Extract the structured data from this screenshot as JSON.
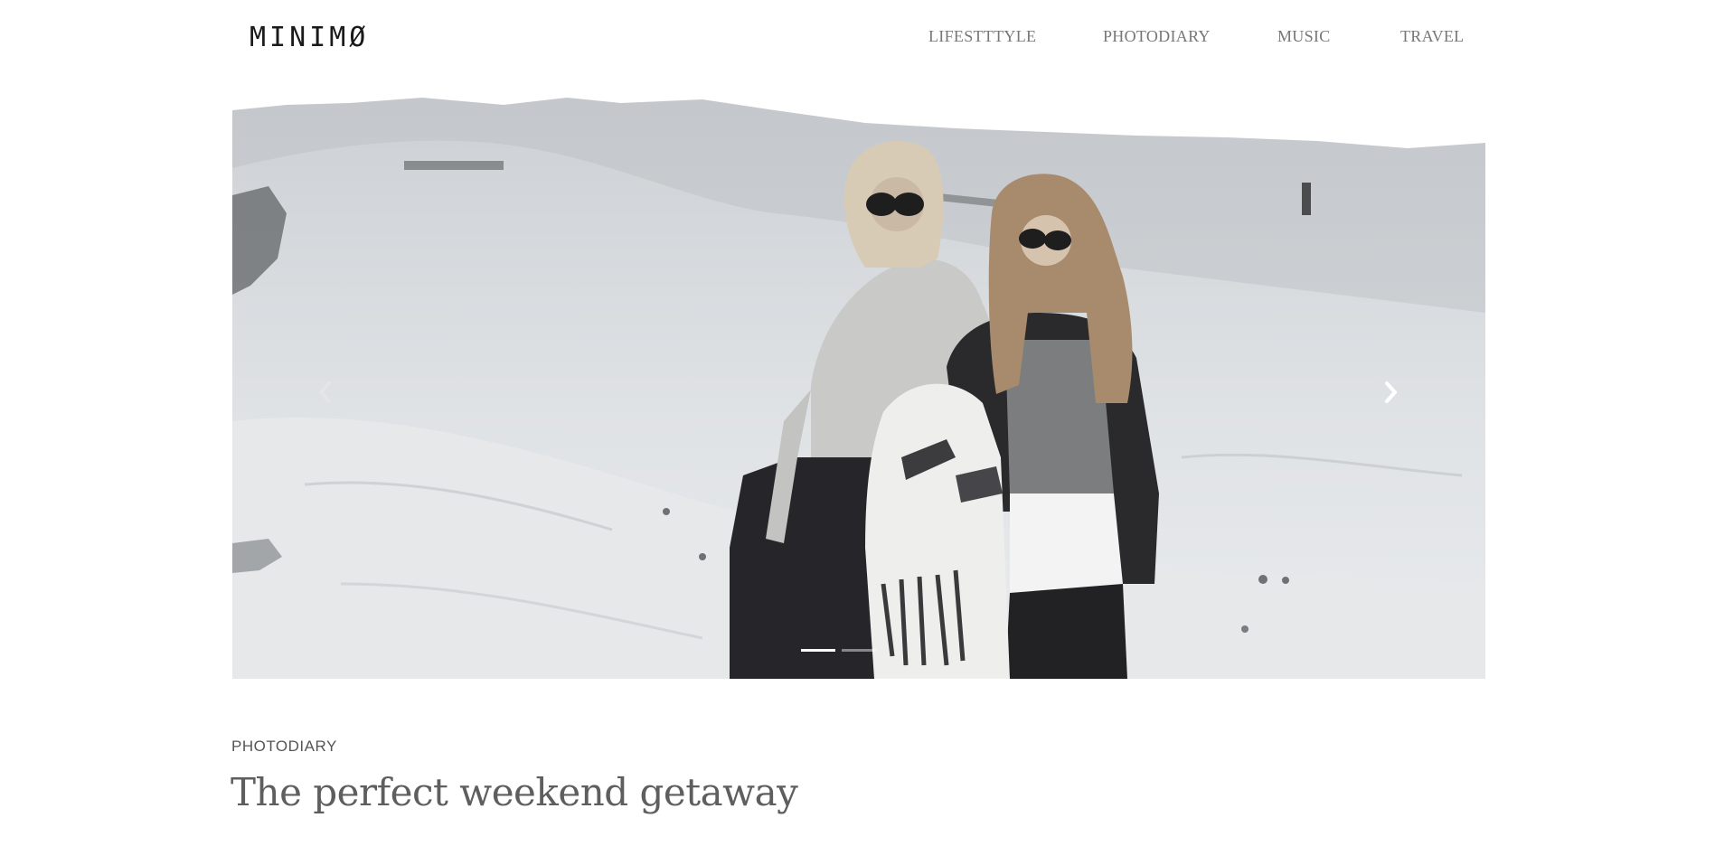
{
  "header": {
    "logo": "MINIMØ",
    "nav": [
      {
        "label": "LIFESTTTYLE"
      },
      {
        "label": "PHOTODIARY"
      },
      {
        "label": "MUSIC"
      },
      {
        "label": "TRAVEL"
      }
    ]
  },
  "slider": {
    "prev_icon": "chevron-left-icon",
    "next_icon": "chevron-right-icon",
    "slide_count": 2,
    "active_slide": 1
  },
  "post": {
    "category": "PHOTODIARY",
    "title": "The perfect weekend getaway"
  },
  "colors": {
    "text_dark": "#1a1a1a",
    "nav_text": "#777777",
    "title_text": "#5e5e5e"
  }
}
